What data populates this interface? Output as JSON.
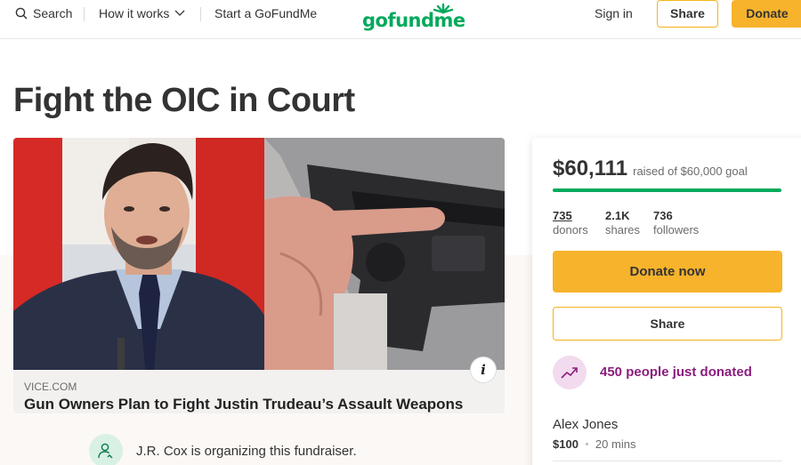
{
  "nav": {
    "search_label": "Search",
    "how_label": "How it works",
    "start_label": "Start a GoFundMe",
    "logo_text": "gofundme",
    "signin_label": "Sign in",
    "share_label": "Share",
    "donate_label": "Donate"
  },
  "campaign": {
    "title": "Fight the OIC in Court",
    "media": {
      "source": "VICE.COM",
      "headline": "Gun Owners Plan to Fight Justin Trudeau’s Assault Weapons",
      "info_glyph": "i"
    },
    "organizer_text": "J.R. Cox is organizing this fundraiser."
  },
  "sidebar": {
    "raised_amount": "$60,111",
    "goal_text": "raised of $60,000 goal",
    "progress_fraction": 1.0,
    "stats": [
      {
        "value": "735",
        "label": "donors"
      },
      {
        "value": "2.1K",
        "label": "shares"
      },
      {
        "value": "736",
        "label": "followers"
      }
    ],
    "donate_now_label": "Donate now",
    "share_label": "Share",
    "recent_text": "450 people just donated",
    "latest_donation": {
      "name": "Alex Jones",
      "amount": "$100",
      "time": "20 mins"
    }
  },
  "colors": {
    "brand_green": "#02a95c",
    "donate_yellow": "#f7b32b",
    "share_border": "#f6b21d",
    "trend_purple": "#8a1d7e"
  },
  "icons": [
    "search-icon",
    "chevron-down-icon",
    "info-icon",
    "organizer-icon",
    "trending-up-icon"
  ]
}
